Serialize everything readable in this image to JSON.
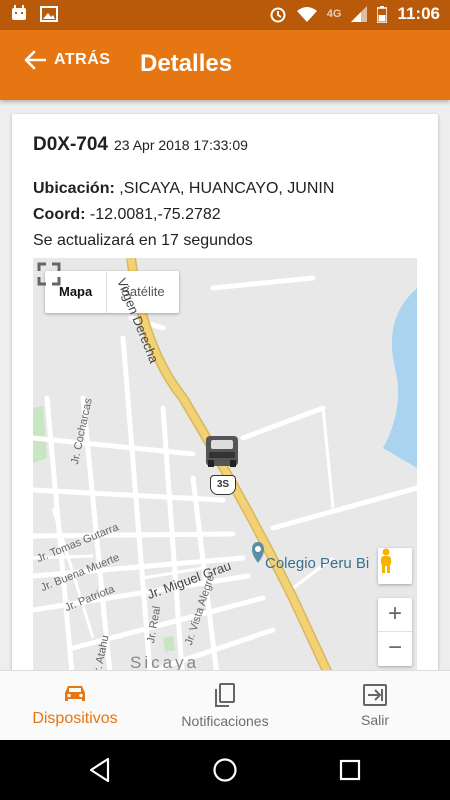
{
  "status_bar": {
    "time": "11:06",
    "network": "4G"
  },
  "app_bar": {
    "back_label": "ATRÁS",
    "title": "Detalles"
  },
  "device": {
    "plate": "D0X-704",
    "timestamp": "23 Apr 2018 17:33:09",
    "location_label": "Ubicación:",
    "location_value": " ,SICAYA, HUANCAYO, JUNIN",
    "coord_label": "Coord:",
    "coord_value": " -12.0081,-75.2782",
    "refresh_text": "Se actualizará en 17 segundos"
  },
  "map": {
    "type_map": "Mapa",
    "type_satellite": "Satélite",
    "zoom_in": "+",
    "zoom_out": "−",
    "route_number": "3S",
    "poi": "Colegio Peru Bi",
    "road_main": "Virgen Derecha",
    "road_grau": "Jr. Miguel Grau",
    "town": "Sicaya",
    "streets": [
      "Jr. Cocharcas",
      "Jr. Tomas Gutarra",
      "Jr. Buena Muerte",
      "Jr. Patriota",
      "Jr. Vista Alegre",
      "Jr. Real",
      "Jr. Atahu"
    ],
    "colors": {
      "highway": "#f2d275",
      "water": "#aad3f0",
      "land": "#e8e8e8",
      "road": "#ffffff"
    }
  },
  "bottom_nav": [
    {
      "label": "Dispositivos",
      "icon": "car-icon",
      "active": true
    },
    {
      "label": "Notificaciones",
      "icon": "document-icon",
      "active": false
    },
    {
      "label": "Salir",
      "icon": "exit-icon",
      "active": false
    }
  ],
  "colors": {
    "primary": "#e57611",
    "status_bar": "#b85a0a"
  }
}
